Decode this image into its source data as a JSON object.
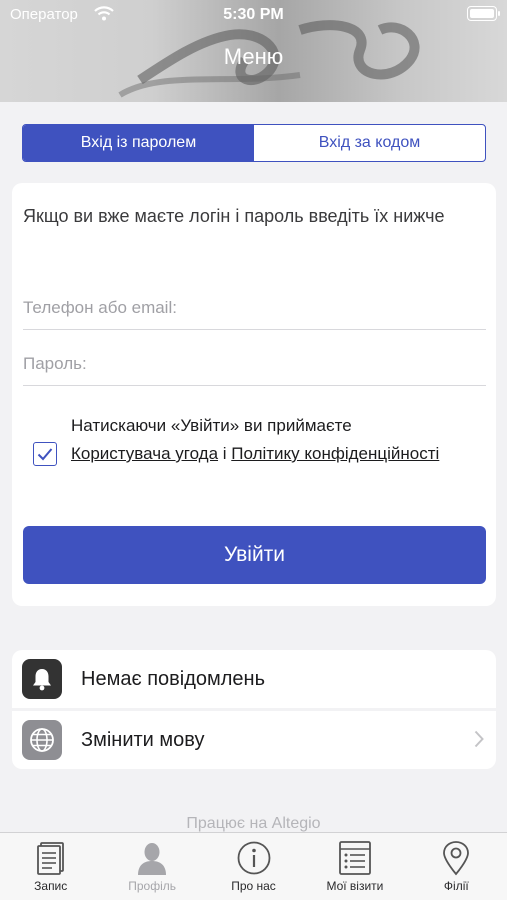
{
  "status_bar": {
    "carrier": "Оператор",
    "time": "5:30 PM"
  },
  "header": {
    "title": "Меню"
  },
  "segmented": {
    "options": [
      {
        "label": "Вхід із паролем",
        "selected": true
      },
      {
        "label": "Вхід за кодом",
        "selected": false
      }
    ]
  },
  "login": {
    "intro": "Якщо ви вже маєте логін і пароль введіть їх нижче",
    "phone_placeholder": "Телефон або email:",
    "phone_value": "",
    "password_placeholder": "Пароль:",
    "password_value": "",
    "agreement_checked": true,
    "agreement_prefix": "Натискаючи «Увійти» ви приймаєте",
    "agreement_link1": "Користувача угода",
    "agreement_and": " і ",
    "agreement_link2": "Політику конфіденційності",
    "submit_label": "Увійти"
  },
  "menu": {
    "items": [
      {
        "label": "Немає повідомлень",
        "icon": "bell-icon"
      },
      {
        "label": "Змінити мову",
        "icon": "globe-icon"
      }
    ]
  },
  "footer": {
    "powered_by": "Працює на Altegio"
  },
  "tabbar": {
    "items": [
      {
        "label": "Запис",
        "icon": "document-icon",
        "active": false
      },
      {
        "label": "Профіль",
        "icon": "person-icon",
        "active": true
      },
      {
        "label": "Про нас",
        "icon": "info-icon",
        "active": false
      },
      {
        "label": "Мої візити",
        "icon": "list-icon",
        "active": false
      },
      {
        "label": "Філії",
        "icon": "location-pin-icon",
        "active": false
      }
    ]
  },
  "colors": {
    "accent": "#3f52bf",
    "background": "#f2f2f4"
  }
}
